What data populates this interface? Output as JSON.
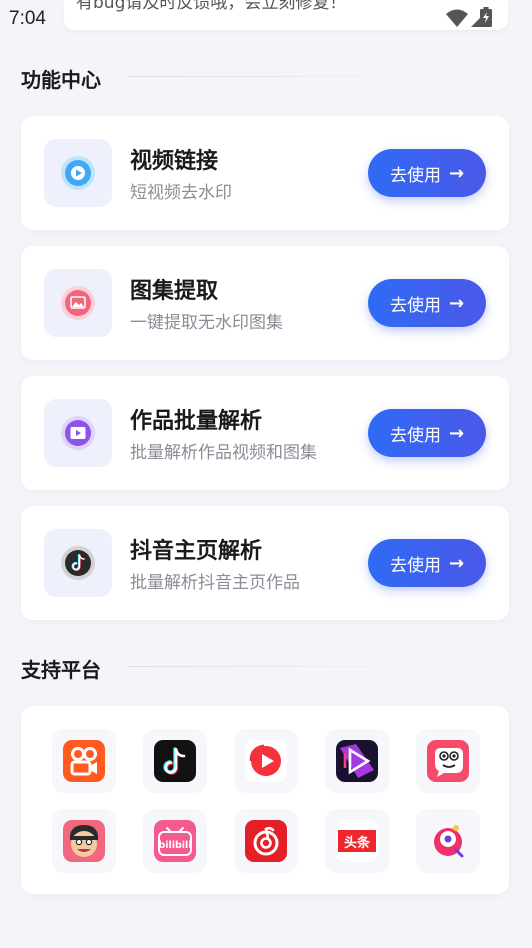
{
  "status_bar": {
    "time": "7:04",
    "notice": "有bug请及时反馈哦，会立刻修复！"
  },
  "features": {
    "section_title": "功能中心",
    "button_label": "去使用",
    "button_arrow": "→",
    "items": [
      {
        "title": "视频链接",
        "subtitle": "短视频去水印",
        "icon": "video-play-icon",
        "color": "#3fa9f5"
      },
      {
        "title": "图集提取",
        "subtitle": "一键提取无水印图集",
        "icon": "image-icon",
        "color": "#f2657d"
      },
      {
        "title": "作品批量解析",
        "subtitle": "批量解析作品视频和图集",
        "icon": "film-icon",
        "color": "#8a55e8"
      },
      {
        "title": "抖音主页解析",
        "subtitle": "批量解析抖音主页作品",
        "icon": "tiktok-icon",
        "color": "#2a2a2a"
      }
    ]
  },
  "platforms": {
    "section_title": "支持平台",
    "items": [
      {
        "name": "kuaishou-icon"
      },
      {
        "name": "douyin-icon"
      },
      {
        "name": "weishi-icon"
      },
      {
        "name": "video-player-icon"
      },
      {
        "name": "pipixia-icon"
      },
      {
        "name": "face-avatar-icon"
      },
      {
        "name": "bilibili-icon",
        "text": "bilibili"
      },
      {
        "name": "netease-music-icon"
      },
      {
        "name": "toutiao-icon",
        "text": "头条"
      },
      {
        "name": "zuiyou-icon"
      }
    ]
  }
}
